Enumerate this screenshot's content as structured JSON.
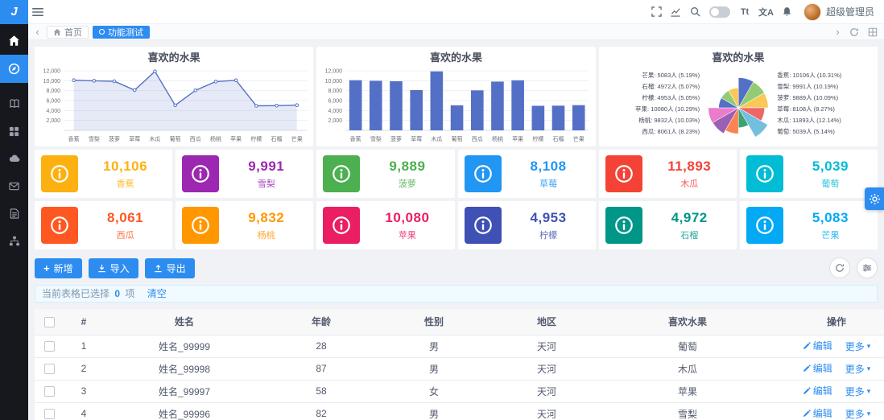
{
  "accent_color": "#2d8cf0",
  "header": {
    "logo_text": "J",
    "font_size_icon": "Tt",
    "translate_icon": "文A",
    "user_name": "超级管理员"
  },
  "tabbar": {
    "left_arrow": "‹",
    "right_arrow": "›",
    "tabs": [
      {
        "label": "首页",
        "active": false
      },
      {
        "label": "功能测试",
        "active": true
      }
    ]
  },
  "chart_data": [
    {
      "type": "line",
      "title": "喜欢的水果",
      "categories": [
        "香蕉",
        "雪梨",
        "菠萝",
        "草莓",
        "木瓜",
        "葡萄",
        "西瓜",
        "杨桃",
        "苹果",
        "柠檬",
        "石榴",
        "芒果"
      ],
      "values": [
        10106,
        9991,
        9889,
        8108,
        11893,
        5039,
        8061,
        9832,
        10080,
        4953,
        4972,
        5083
      ],
      "ylim": [
        0,
        12000
      ],
      "yticks": [
        2000,
        4000,
        6000,
        8000,
        10000,
        12000
      ],
      "grid": true,
      "color": "#5470c6"
    },
    {
      "type": "bar",
      "title": "喜欢的水果",
      "categories": [
        "香蕉",
        "雪梨",
        "菠萝",
        "草莓",
        "木瓜",
        "葡萄",
        "西瓜",
        "杨桃",
        "苹果",
        "柠檬",
        "石榴",
        "芒果"
      ],
      "values": [
        10106,
        9991,
        9889,
        8108,
        11893,
        5039,
        8061,
        9832,
        10080,
        4953,
        4972,
        5083
      ],
      "ylim": [
        0,
        12000
      ],
      "yticks": [
        2000,
        4000,
        6000,
        8000,
        10000,
        12000
      ],
      "grid": true,
      "color": "#5470c6"
    },
    {
      "type": "pie",
      "variant": "rose",
      "title": "喜欢的水果",
      "categories": [
        "香蕉",
        "雪梨",
        "菠萝",
        "草莓",
        "木瓜",
        "葡萄",
        "西瓜",
        "杨桃",
        "苹果",
        "柠檬",
        "石榴",
        "芒果"
      ],
      "values": [
        10106,
        9991,
        9889,
        8108,
        11893,
        5039,
        8061,
        9832,
        10080,
        4953,
        4972,
        5083
      ],
      "percentages": [
        10.31,
        10.19,
        10.09,
        8.27,
        12.14,
        5.14,
        8.23,
        10.03,
        10.29,
        5.05,
        5.07,
        5.19
      ],
      "label_format": "{name}: {value}人 ({pct}%)",
      "palette": [
        "#5470c6",
        "#91cc75",
        "#fac858",
        "#ee6666",
        "#73c0de",
        "#3ba272",
        "#fc8452",
        "#9a60b4",
        "#ea7ccc"
      ]
    }
  ],
  "stat_cards": [
    {
      "value": "10,106",
      "label": "香蕉",
      "color": "#fcb110"
    },
    {
      "value": "9,991",
      "label": "雪梨",
      "color": "#9c27b0"
    },
    {
      "value": "9,889",
      "label": "菠萝",
      "color": "#4caf50"
    },
    {
      "value": "8,108",
      "label": "草莓",
      "color": "#2196f3"
    },
    {
      "value": "11,893",
      "label": "木瓜",
      "color": "#f44336"
    },
    {
      "value": "5,039",
      "label": "葡萄",
      "color": "#00bcd4"
    },
    {
      "value": "8,061",
      "label": "西瓜",
      "color": "#ff5722"
    },
    {
      "value": "9,832",
      "label": "杨桃",
      "color": "#ff9800"
    },
    {
      "value": "10,080",
      "label": "苹果",
      "color": "#e91e63"
    },
    {
      "value": "4,953",
      "label": "柠檬",
      "color": "#3f51b5"
    },
    {
      "value": "4,972",
      "label": "石榴",
      "color": "#009688"
    },
    {
      "value": "5,083",
      "label": "芒果",
      "color": "#03a9f4"
    }
  ],
  "toolbar": {
    "add": "新增",
    "import": "导入",
    "export": "导出"
  },
  "selection": {
    "prefix": "当前表格已选择",
    "count": "0",
    "suffix": "项",
    "clear": "清空"
  },
  "table": {
    "columns": [
      "#",
      "姓名",
      "年龄",
      "性别",
      "地区",
      "喜欢水果",
      "操作"
    ],
    "rows": [
      {
        "index": "1",
        "name": "姓名_99999",
        "age": "28",
        "gender": "男",
        "region": "天河",
        "fruit": "葡萄"
      },
      {
        "index": "2",
        "name": "姓名_99998",
        "age": "87",
        "gender": "男",
        "region": "天河",
        "fruit": "木瓜"
      },
      {
        "index": "3",
        "name": "姓名_99997",
        "age": "58",
        "gender": "女",
        "region": "天河",
        "fruit": "苹果"
      },
      {
        "index": "4",
        "name": "姓名_99996",
        "age": "82",
        "gender": "男",
        "region": "天河",
        "fruit": "雪梨"
      }
    ],
    "actions": {
      "edit": "编辑",
      "more": "更多"
    }
  }
}
